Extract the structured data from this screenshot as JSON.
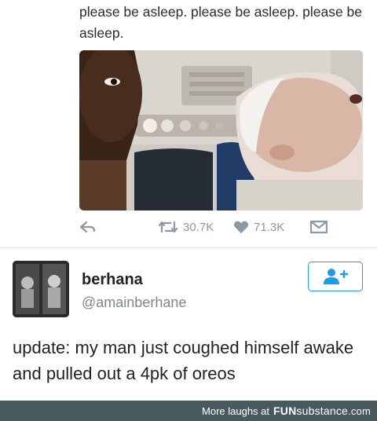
{
  "tweet_top": {
    "text": "please be asleep. please be asleep. please be asleep."
  },
  "actions": {
    "retweets": "30.7K",
    "likes": "71.3K"
  },
  "user": {
    "name": "berhana",
    "handle": "@amainberhane"
  },
  "tweet": {
    "text": "update: my man just coughed himself awake and pulled out a 4pk of oreos"
  },
  "footer": {
    "prefix": "More laughs at",
    "brand_bold": "FUN",
    "brand_light": "substance",
    "domain": ".com"
  },
  "colors": {
    "accent": "#1d9bf0",
    "footer_bg": "#485a5f",
    "muted": "#8a99a6"
  },
  "icons": [
    "reply-icon",
    "retweet-icon",
    "heart-icon",
    "direct-message-icon",
    "follow-user-icon"
  ]
}
